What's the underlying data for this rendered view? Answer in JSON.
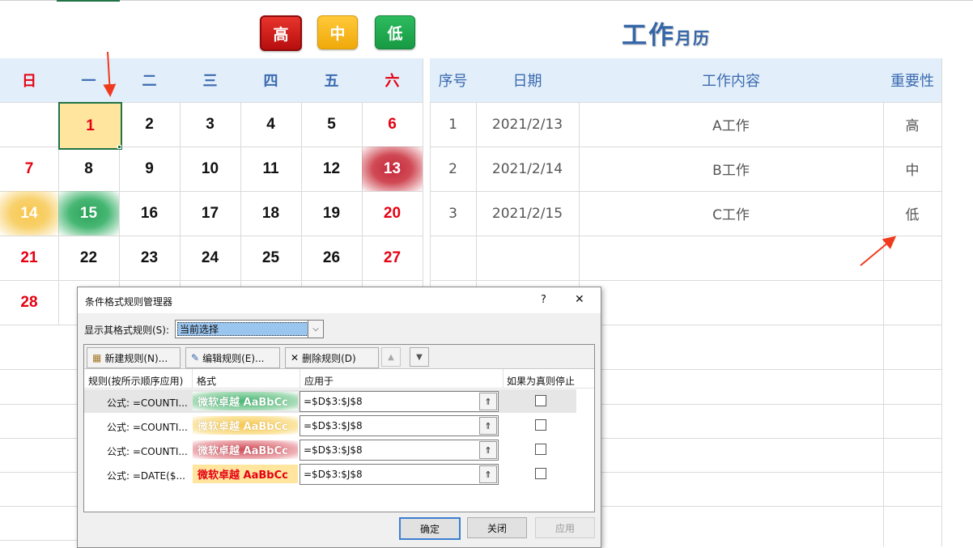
{
  "badges": {
    "high": "高",
    "mid": "中",
    "low": "低"
  },
  "colors": {
    "high": "#d11a1a",
    "mid": "#f5b81b",
    "low": "#23a34d",
    "header_blue": "#3c6ab0",
    "sunday_red": "#e60012",
    "accent_blue": "#3466a8"
  },
  "calendar_title": {
    "big": "工作",
    "small": "月历"
  },
  "weekdays": [
    "日",
    "一",
    "二",
    "三",
    "四",
    "五",
    "六"
  ],
  "days": [
    "1",
    "2",
    "3",
    "4",
    "5",
    "6",
    "7",
    "8",
    "9",
    "10",
    "11",
    "12",
    "13",
    "14",
    "15",
    "16",
    "17",
    "18",
    "19",
    "20",
    "21",
    "22",
    "23",
    "24",
    "25",
    "26",
    "27",
    "28"
  ],
  "work_table": {
    "headers": [
      "序号",
      "日期",
      "工作内容",
      "重要性"
    ],
    "rows": [
      {
        "no": "1",
        "date": "2021/2/13",
        "content": "A工作",
        "level": "高"
      },
      {
        "no": "2",
        "date": "2021/2/14",
        "content": "B工作",
        "level": "中"
      },
      {
        "no": "3",
        "date": "2021/2/15",
        "content": "C工作",
        "level": "低"
      }
    ]
  },
  "dialog": {
    "title": "条件格式规则管理器",
    "help": "?",
    "close": "✕",
    "show_rules_label": "显示其格式规则(S):",
    "show_rules_value": "当前选择",
    "new_rule": "新建规则(N)...",
    "edit_rule": "编辑规则(E)...",
    "delete_rule": "删除规则(D)",
    "col_rule": "规则(按所示顺序应用)",
    "col_format": "格式",
    "col_apply": "应用于",
    "col_stop": "如果为真则停止",
    "rules": [
      {
        "rule": "公式: =COUNTI...",
        "format": "微软卓越  AaBbCc",
        "apply": "=$D$3:$J$8"
      },
      {
        "rule": "公式: =COUNTI...",
        "format": "微软卓越  AaBbCc",
        "apply": "=$D$3:$J$8"
      },
      {
        "rule": "公式: =COUNTI...",
        "format": "微软卓越  AaBbCc",
        "apply": "=$D$3:$J$8"
      },
      {
        "rule": "公式: =DATE($...",
        "format": "微软卓越  AaBbCc",
        "apply": "=$D$3:$J$8"
      }
    ],
    "ok": "确定",
    "close_btn": "关闭",
    "apply_btn": "应用"
  }
}
